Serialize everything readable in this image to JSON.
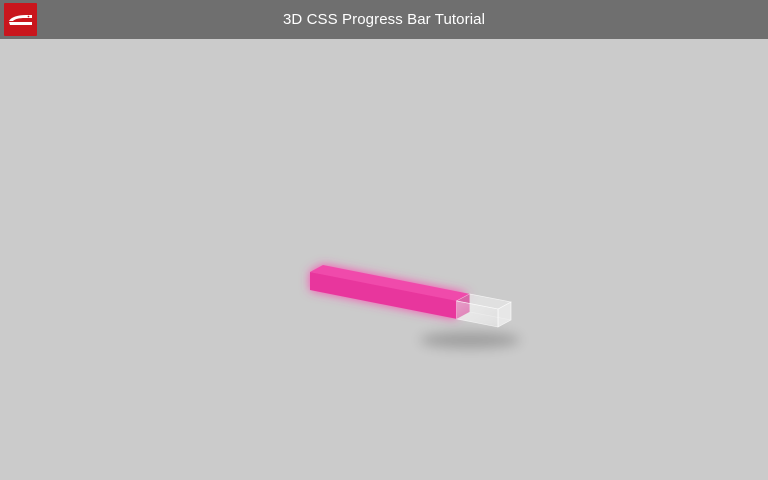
{
  "header": {
    "title": "3D CSS Progress Bar Tutorial",
    "logo_icon": "stapler-logo-icon",
    "background_color": "#6f6f6f",
    "logo_color": "#c9161d"
  },
  "progress_bar": {
    "progress_fraction": 0.78,
    "fill_color": "#e8369d",
    "glow_color": "#ff3fae",
    "empty_color": "#ffffff"
  },
  "page": {
    "background_color": "#cbcbcb"
  }
}
